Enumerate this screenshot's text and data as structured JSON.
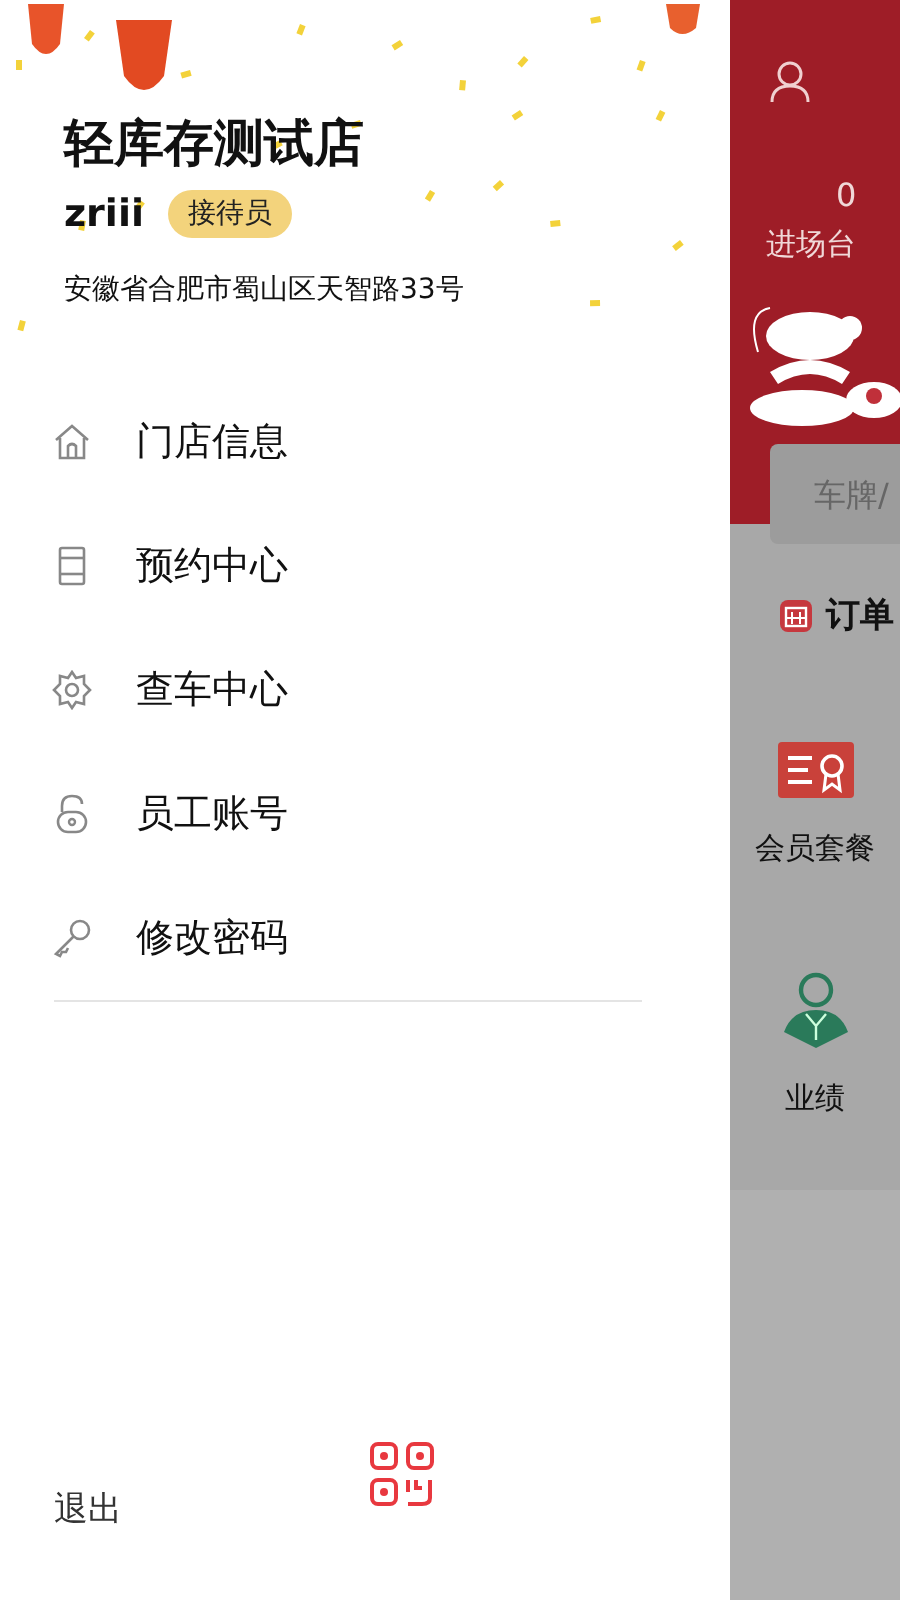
{
  "drawer": {
    "store_name": "轻库存测试店",
    "user": "zriii",
    "role_badge": "接待员",
    "address": "安徽省合肥市蜀山区天智路33号",
    "menu": [
      {
        "kind": "house",
        "label": "门店信息"
      },
      {
        "kind": "phone",
        "label": "预约中心"
      },
      {
        "kind": "gear",
        "label": "查车中心"
      },
      {
        "kind": "lock",
        "label": "员工账号"
      },
      {
        "kind": "key",
        "label": "修改密码"
      }
    ],
    "logout": "退出"
  },
  "background_screen": {
    "count": "0",
    "count_label": "进场台",
    "search": {
      "placeholder": "车牌/"
    },
    "section_title": "订单",
    "tiles": [
      {
        "kind": "card",
        "label": "会员套餐"
      },
      {
        "kind": "person",
        "label": "业绩"
      }
    ]
  }
}
